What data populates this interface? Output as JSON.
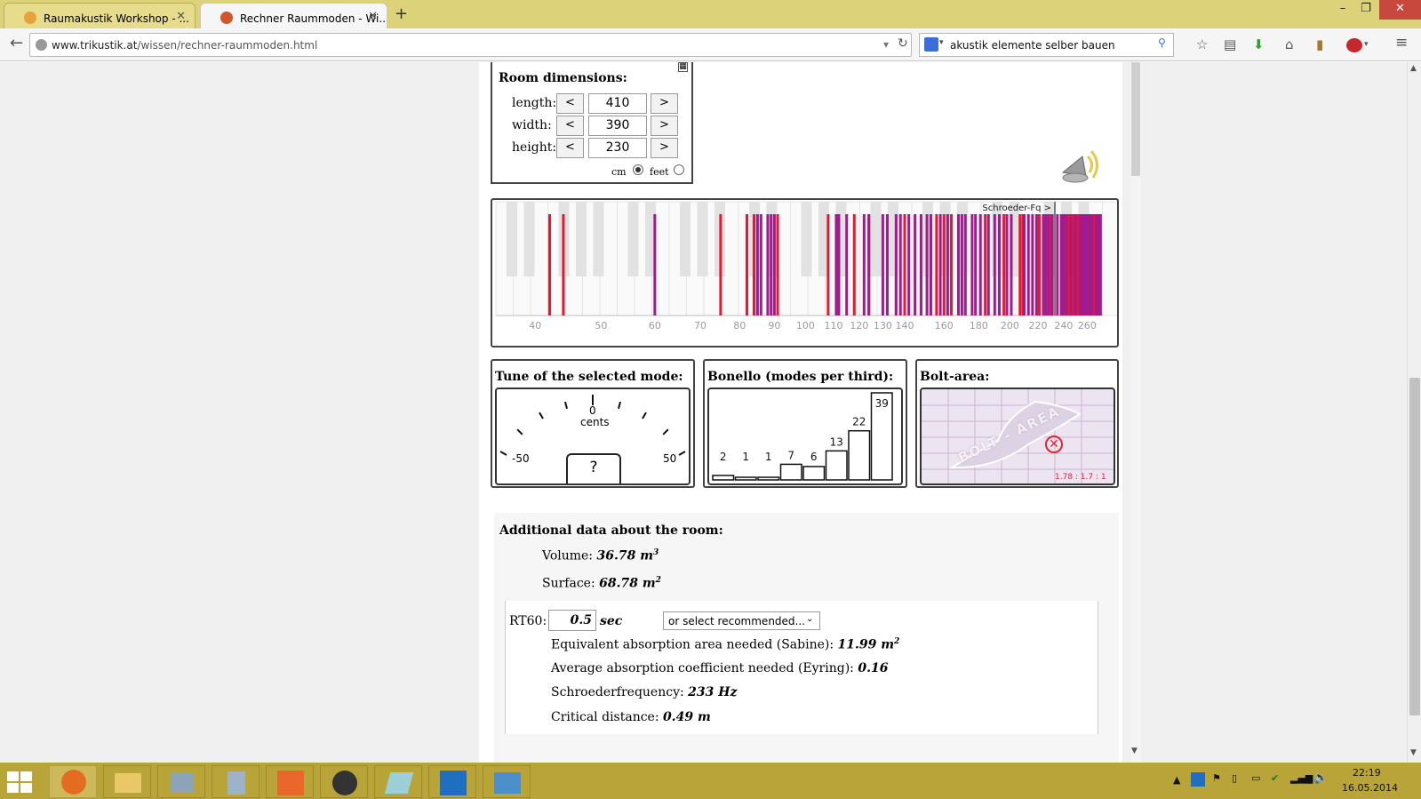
{
  "browser": {
    "tabs": [
      {
        "label": "Raumakustik Workshop - ...",
        "active": false
      },
      {
        "label": "Rechner Raummoden - Wi...",
        "active": true
      }
    ],
    "url_domain": "www.trikustik.at",
    "url_path": "/wissen/rechner-raummoden.html",
    "search_query": "akustik elemente selber bauen"
  },
  "room": {
    "heading": "Room dimensions:",
    "length_label": "length:",
    "width_label": "width:",
    "height_label": "height:",
    "length": "410",
    "width": "390",
    "height": "230",
    "dec_label": "<",
    "inc_label": ">",
    "unit_cm": "cm",
    "unit_feet": "feet",
    "selected_unit": "cm"
  },
  "chart_data": {
    "type": "bar",
    "title": "",
    "annotation": "Schroeder-Fq >",
    "x_scale": "log",
    "xlim": [
      35,
      275
    ],
    "x_ticks": [
      40,
      50,
      60,
      70,
      80,
      90,
      100,
      110,
      120,
      130,
      140,
      160,
      180,
      200,
      220,
      240,
      260
    ],
    "schroeder_frequency": 233,
    "series": [
      {
        "color": "#e4182f",
        "x": [
          42,
          44,
          75,
          82,
          84,
          91,
          108,
          118,
          124,
          140,
          156,
          160,
          164,
          184,
          196,
          207,
          209,
          221,
          230,
          244,
          248,
          252,
          266
        ]
      },
      {
        "color": "#a01b8c",
        "x": [
          60,
          85,
          86,
          88,
          89,
          90,
          111,
          112,
          115,
          122,
          124,
          130,
          132,
          136,
          138,
          142,
          145,
          148,
          151,
          153,
          158,
          162,
          168,
          170,
          172,
          176,
          178,
          181,
          186,
          190,
          193,
          198,
          201,
          210,
          213,
          216,
          219,
          224,
          226,
          228,
          231,
          235,
          238,
          240,
          242,
          246,
          250,
          254,
          256,
          258,
          260,
          262,
          264,
          268,
          270,
          272
        ]
      }
    ]
  },
  "tune": {
    "heading": "Tune of the selected mode:",
    "zero_label": "0",
    "unit": "cents",
    "min_label": "-50",
    "max_label": "50",
    "value": "?"
  },
  "bonello": {
    "heading": "Bonello (modes per third):",
    "values": [
      2,
      1,
      1,
      7,
      6,
      13,
      22,
      39
    ],
    "ymax": 39
  },
  "bolt": {
    "heading": "Bolt-area:",
    "watermark": "BOLT - AREA",
    "ratio": "1.78 : 1.7 : 1"
  },
  "additional": {
    "heading": "Additional data about the room:",
    "volume_label": "Volume:",
    "volume_value": "36.78 m",
    "volume_exp": "3",
    "surface_label": "Surface:",
    "surface_value": "68.78 m",
    "surface_exp": "2",
    "rt60_label": "RT60:",
    "rt60_value": "0.5",
    "rt60_unit": "sec",
    "recommend_placeholder": "or select recommended...",
    "sabine_label": "Equivalent absorption area needed (Sabine):",
    "sabine_value": "11.99 m",
    "sabine_exp": "2",
    "eyring_label": "Average absorption coefficient needed (Eyring):",
    "eyring_value": "0.16",
    "schroeder_label": "Schroederfrequency:",
    "schroeder_value": "233 Hz",
    "critical_label": "Critical distance:",
    "critical_value": "0.49 m"
  },
  "taskbar": {
    "time": "22:19",
    "date": "16.05.2014"
  }
}
